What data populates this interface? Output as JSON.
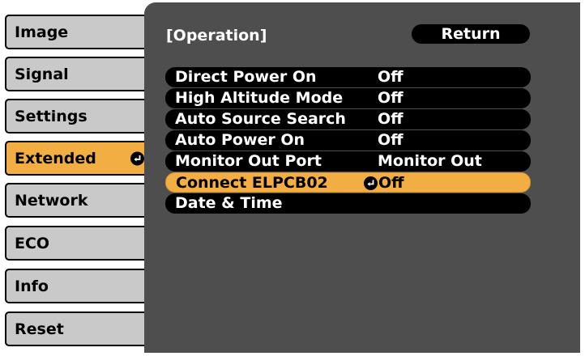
{
  "sidebar": {
    "items": [
      {
        "label": "Image"
      },
      {
        "label": "Signal"
      },
      {
        "label": "Settings"
      },
      {
        "label": "Extended",
        "active": true
      },
      {
        "label": "Network"
      },
      {
        "label": "ECO"
      },
      {
        "label": "Info"
      },
      {
        "label": "Reset"
      }
    ]
  },
  "panel": {
    "title": "[Operation]",
    "return_label": "Return",
    "rows": [
      {
        "label": "Direct Power On",
        "value": "Off"
      },
      {
        "label": "High Altitude Mode",
        "value": "Off"
      },
      {
        "label": "Auto Source Search",
        "value": "Off"
      },
      {
        "label": "Auto Power On",
        "value": "Off"
      },
      {
        "label": "Monitor Out Port",
        "value": "Monitor Out"
      },
      {
        "label": "Connect ELPCB02",
        "value": "Off",
        "selected": true
      },
      {
        "label": "Date & Time",
        "value": ""
      }
    ]
  },
  "colors": {
    "sidebar_bg": "#c9c9c9",
    "highlight": "#f3ae43",
    "panel_bg": "#4e4e4e",
    "row_bg": "#000000"
  },
  "icons": {
    "enter": "enter-icon"
  }
}
